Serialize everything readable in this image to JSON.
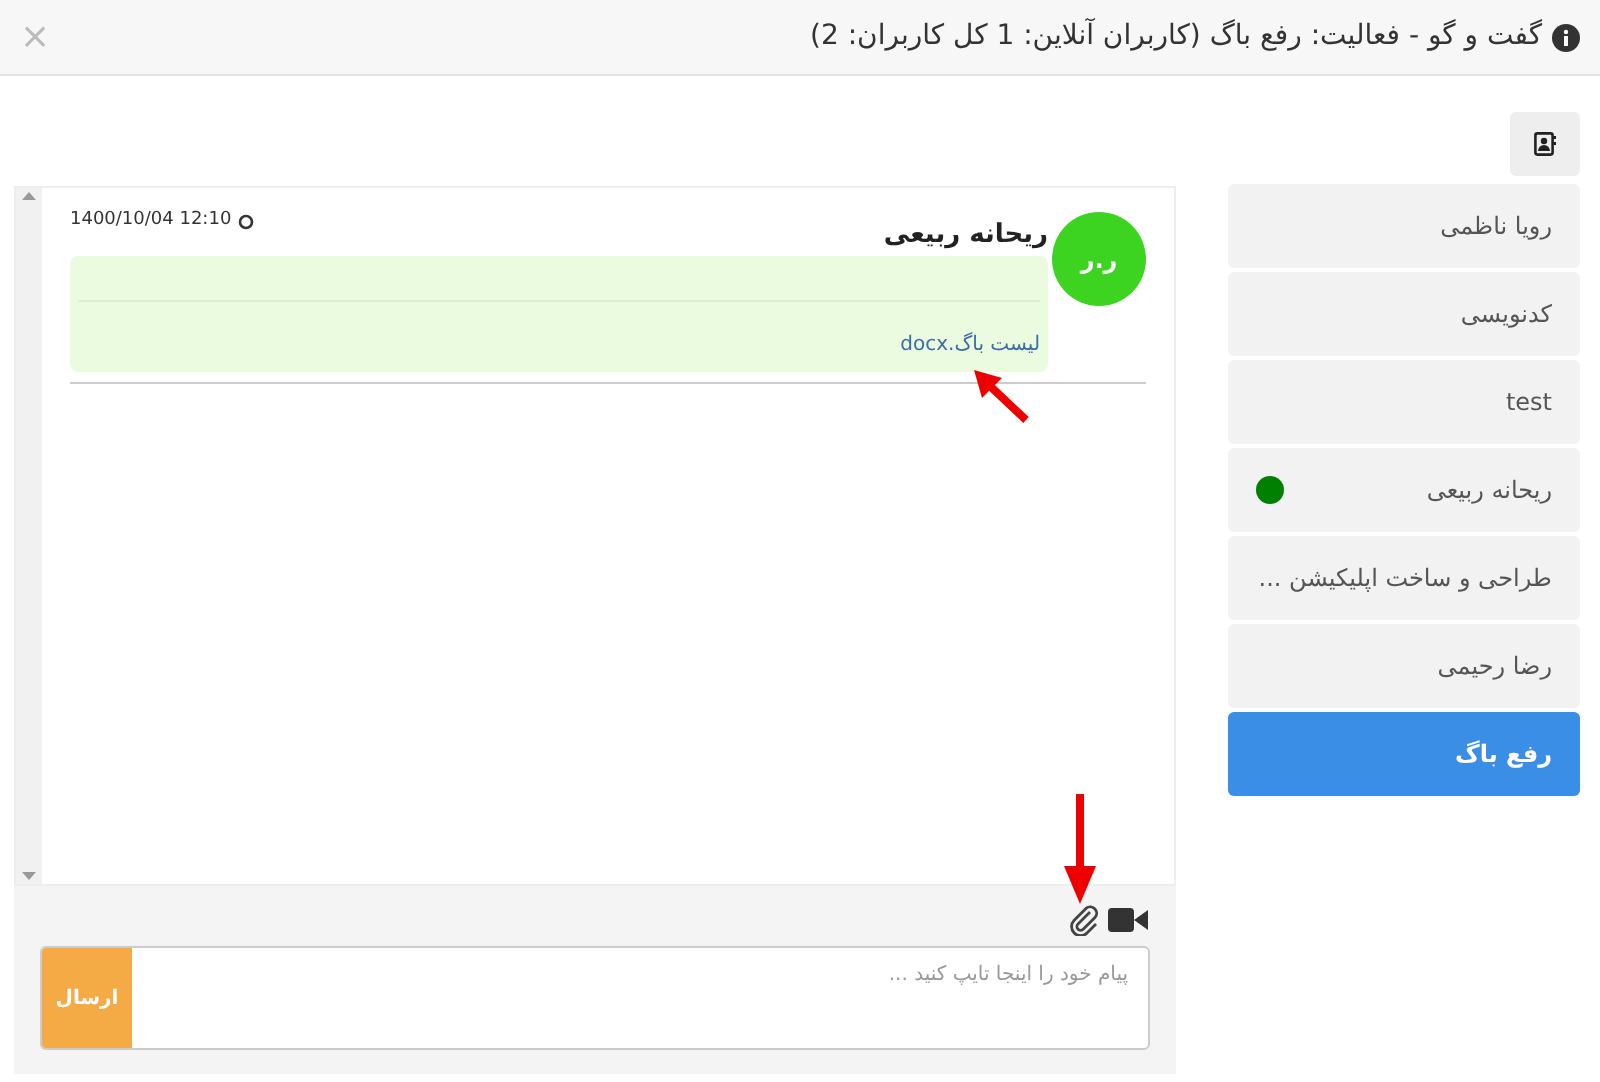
{
  "dialog": {
    "title": "گفت و گو - فعالیت: رفع باگ (کاربران آنلاین: 1 کل کاربران: 2)",
    "close": "×"
  },
  "contacts": [
    {
      "name": "رویا ناظمی",
      "selected": false,
      "online": false
    },
    {
      "name": "کدنویسی",
      "selected": false,
      "online": false
    },
    {
      "name": "test",
      "selected": false,
      "online": false
    },
    {
      "name": "ریحانه ربیعی",
      "selected": false,
      "online": true
    },
    {
      "name": "طراحی و ساخت اپلیکیشن ...",
      "selected": false,
      "online": false
    },
    {
      "name": "رضا رحیمی",
      "selected": false,
      "online": false
    },
    {
      "name": "رفع باگ",
      "selected": true,
      "online": false
    }
  ],
  "messages": [
    {
      "sender": "ریحانه ربیعی",
      "initials": "ر.ر",
      "time": "1400/10/04 12:10",
      "attachment": "لیست باگ.docx"
    }
  ],
  "composer": {
    "placeholder": "پیام خود را اینجا تایپ کنید ...",
    "send": "ارسال"
  }
}
